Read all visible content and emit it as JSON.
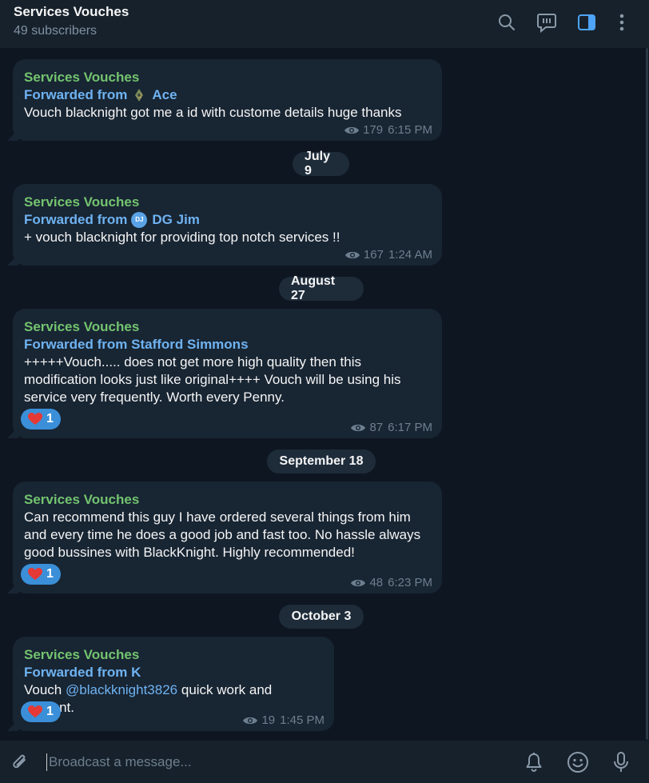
{
  "header": {
    "title": "Services Vouches",
    "subtitle": "49 subscribers",
    "icons": [
      "search-icon",
      "comments-icon",
      "side-panel-icon",
      "more-vert-icon"
    ],
    "accent": "#6fb3f2"
  },
  "messages": [
    {
      "sender": "Services Vouches",
      "forward_prefix": "Forwarded from",
      "forward_name": "Ace",
      "text": "Vouch blacknight got me a id with custome details huge thanks",
      "views": "179",
      "time": "6:15 PM"
    },
    {
      "sender": "Services Vouches",
      "forward_prefix": "Forwarded from",
      "forward_name": "DG Jim",
      "forward_avatar": "DJ",
      "text": "+ vouch blacknight for providing top notch services !!",
      "views": "167",
      "time": "1:24 AM"
    },
    {
      "sender": "Services Vouches",
      "forward_full": "Forwarded from Stafford Simmons",
      "text": "+++++Vouch..... does not get more high quality then this modification looks just like original++++ Vouch will be using his service very frequently. Worth every Penny.",
      "reaction_count": "1",
      "views": "87",
      "time": "6:17 PM"
    },
    {
      "sender": "Services Vouches",
      "text": "Can recommend this guy I have ordered several things from him and every time he does a good job and fast too. No hassle always good bussines with BlackKnight. Highly recommended!",
      "reaction_count": "1",
      "views": "48",
      "time": "6:23 PM"
    },
    {
      "sender": "Services Vouches",
      "forward_full": "Forwarded from K",
      "text_before": "Vouch ",
      "mention": "@blackknight3826",
      "text_after": " quick work and efficient.",
      "reaction_count": "1",
      "views": "19",
      "time": "1:45 PM"
    }
  ],
  "dates": [
    "July 9",
    "August 27",
    "September 18",
    "October 3"
  ],
  "composer": {
    "placeholder": "Broadcast a message...",
    "icons": [
      "attach-icon",
      "bell-icon",
      "emoji-icon",
      "microphone-icon"
    ]
  },
  "colors": {
    "background": "#0e1621",
    "bubble": "#182533",
    "sender": "#73c46f",
    "forward": "#6fb3f2",
    "reaction": "#3a8fd8"
  }
}
